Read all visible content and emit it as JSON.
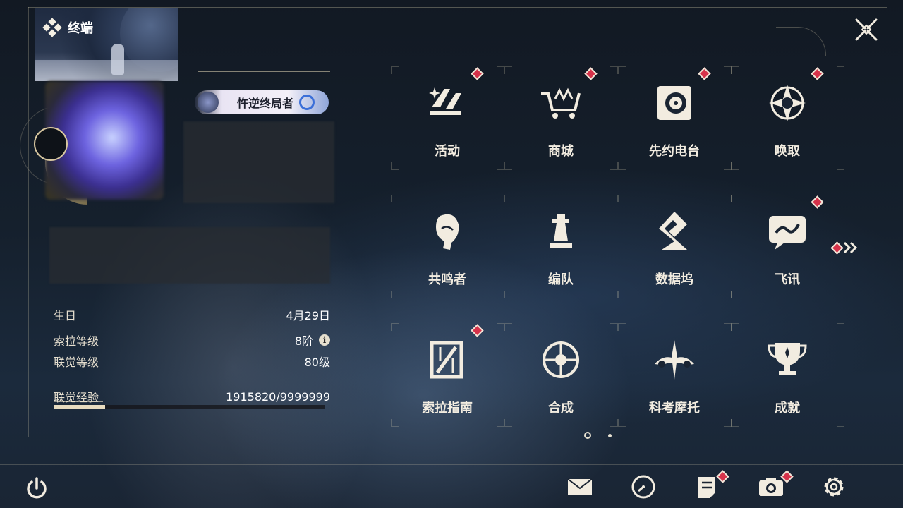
{
  "panel": {
    "title": "终端",
    "title_badge": "忤逆终局者"
  },
  "profile": {
    "stats": [
      {
        "label": "生日",
        "value": "4月29日"
      },
      {
        "label": "索拉等级",
        "value": "8阶"
      },
      {
        "label": "联觉等级",
        "value": "80级"
      }
    ],
    "experience": {
      "label": "联觉经验",
      "value": "1915820/9999999",
      "progress": 0.19
    }
  },
  "menu": {
    "items": [
      {
        "label": "活动",
        "icon": "activity-icon",
        "badge": true
      },
      {
        "label": "商城",
        "icon": "shop-cart-icon",
        "badge": true
      },
      {
        "label": "先约电台",
        "icon": "radio-icon",
        "badge": true
      },
      {
        "label": "唤取",
        "icon": "convene-icon",
        "badge": true
      },
      {
        "label": "共鸣者",
        "icon": "resonator-icon",
        "badge": false
      },
      {
        "label": "编队",
        "icon": "team-chess-icon",
        "badge": false
      },
      {
        "label": "数据坞",
        "icon": "data-bank-icon",
        "badge": false
      },
      {
        "label": "飞讯",
        "icon": "message-icon",
        "badge": true
      },
      {
        "label": "索拉指南",
        "icon": "guide-book-icon",
        "badge": true
      },
      {
        "label": "合成",
        "icon": "synthesis-icon",
        "badge": false
      },
      {
        "label": "科考摩托",
        "icon": "motorcycle-icon",
        "badge": false
      },
      {
        "label": "成就",
        "icon": "trophy-icon",
        "badge": false
      }
    ],
    "pages": 2,
    "current_page": 1
  },
  "bottom_bar": {
    "buttons": [
      {
        "icon": "mail-icon",
        "badge": false
      },
      {
        "icon": "clock-icon",
        "badge": false
      },
      {
        "icon": "notice-icon",
        "badge": true
      },
      {
        "icon": "camera-icon",
        "badge": true
      },
      {
        "icon": "gear-icon",
        "badge": false
      }
    ]
  },
  "colors": {
    "accent": "#e8dcc0",
    "badge": "#d6324a",
    "background": "#15202d"
  }
}
